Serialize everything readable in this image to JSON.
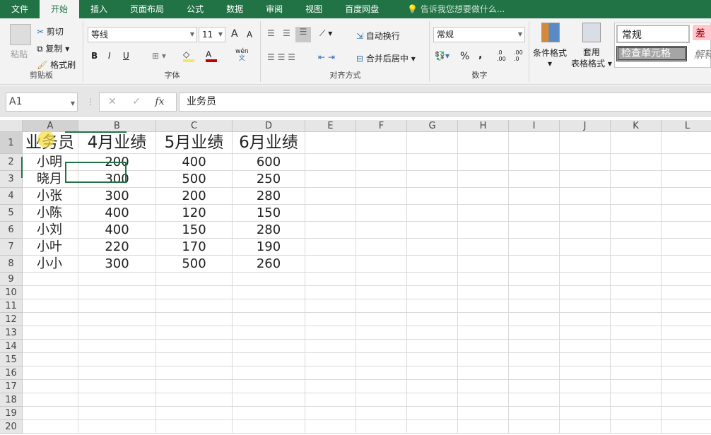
{
  "tabs": [
    "文件",
    "开始",
    "插入",
    "页面布局",
    "公式",
    "数据",
    "审阅",
    "视图",
    "百度网盘"
  ],
  "tell_me": "告诉我您想要做什么...",
  "clipboard": {
    "paste": "粘贴",
    "cut": "剪切",
    "copy": "复制",
    "format_painter": "格式刷",
    "label": "剪贴板"
  },
  "font": {
    "name": "等线",
    "size": "11",
    "bold": "B",
    "italic": "I",
    "underline": "U",
    "phonetic": "wén",
    "phonetic2": "文",
    "grow": "A",
    "shrink": "A",
    "color_letter": "A",
    "label": "字体",
    "fill_color": "#f5e75c",
    "font_color": "#c00000"
  },
  "alignment": {
    "wrap": "自动换行",
    "merge": "合并后居中",
    "label": "对齐方式"
  },
  "number": {
    "format": "常规",
    "percent": "%",
    "comma": ",",
    "inc": ".0\n.00",
    "dec": ".00\n.0",
    "label": "数字"
  },
  "styles": {
    "conditional": "条件格式",
    "table_format_1": "套用",
    "table_format_2": "表格格式",
    "normal": "常规",
    "bad": "差",
    "check_cell": "检查单元格",
    "explain": "解释"
  },
  "formula_bar": {
    "name_box": "A1",
    "fx": "fx",
    "cancel": "✕",
    "enter": "✓",
    "value": "业务员"
  },
  "grid": {
    "columns": [
      "A",
      "B",
      "C",
      "D",
      "E",
      "F",
      "G",
      "H",
      "I",
      "J",
      "K",
      "L"
    ],
    "row_numbers": [
      "1",
      "2",
      "3",
      "4",
      "5",
      "6",
      "7",
      "8",
      "9",
      "10",
      "11",
      "12",
      "13",
      "14",
      "15",
      "16",
      "17",
      "18",
      "19",
      "20"
    ],
    "rows": [
      [
        "业务员",
        "4月业绩",
        "5月业绩",
        "6月业绩"
      ],
      [
        "小明",
        "200",
        "400",
        "600"
      ],
      [
        "晓月",
        "300",
        "500",
        "250"
      ],
      [
        "小张",
        "300",
        "200",
        "280"
      ],
      [
        "小陈",
        "400",
        "120",
        "150"
      ],
      [
        "小刘",
        "400",
        "150",
        "280"
      ],
      [
        "小叶",
        "220",
        "170",
        "190"
      ],
      [
        "小小",
        "300",
        "500",
        "260"
      ]
    ]
  },
  "accent": "#217346"
}
